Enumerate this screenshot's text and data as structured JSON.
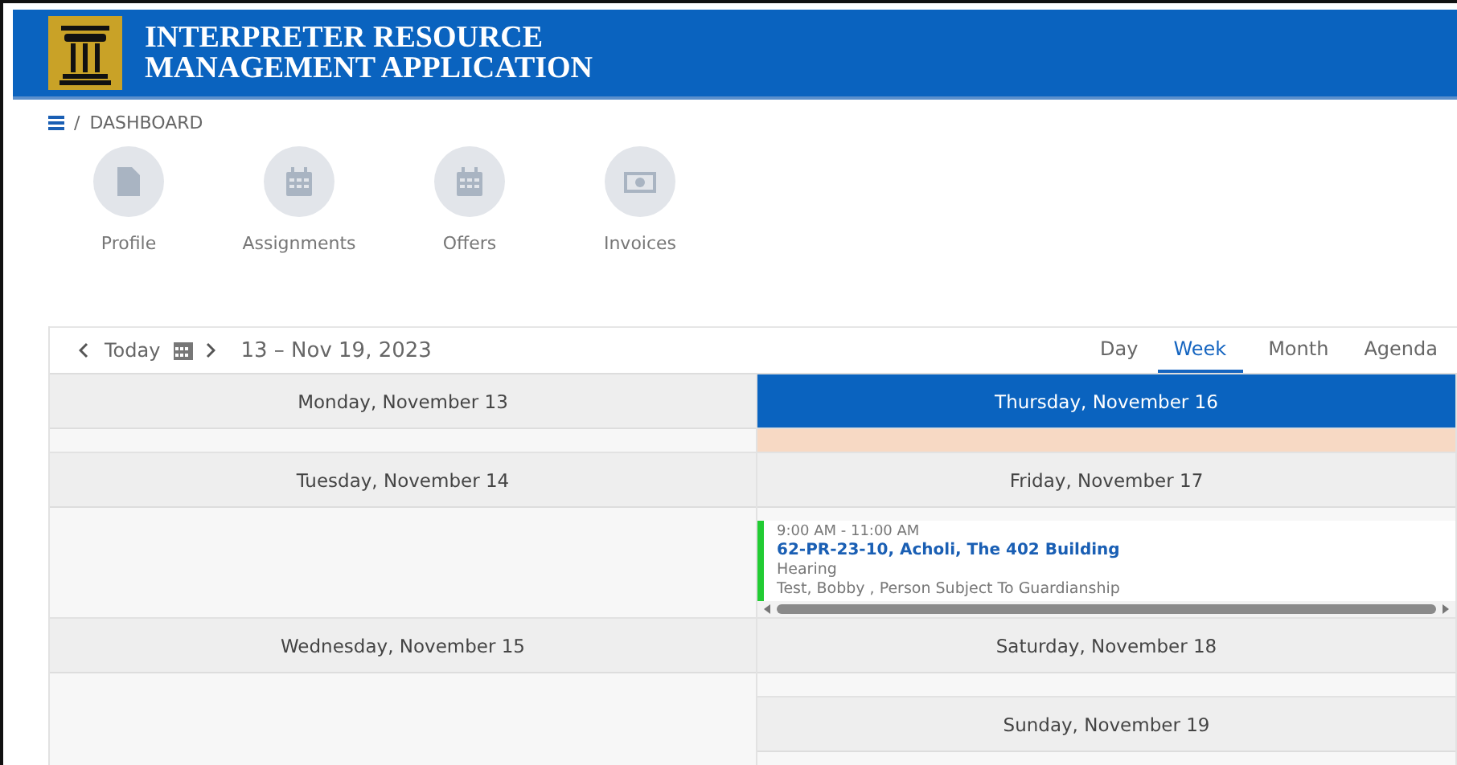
{
  "header": {
    "title_lines": [
      "INTERPRETER RESOURCE",
      "MANAGEMENT APPLICATION"
    ]
  },
  "breadcrumb": {
    "separator": "/",
    "current": "DASHBOARD"
  },
  "shortcuts": [
    {
      "label": "Profile",
      "kind": "document"
    },
    {
      "label": "Assignments",
      "kind": "calendar"
    },
    {
      "label": "Offers",
      "kind": "calendar"
    },
    {
      "label": "Invoices",
      "kind": "money"
    }
  ],
  "calendar": {
    "today_label": "Today",
    "range": "13 – Nov 19, 2023",
    "views": [
      {
        "label": "Day",
        "selected": false
      },
      {
        "label": "Week",
        "selected": true
      },
      {
        "label": "Month",
        "selected": false
      },
      {
        "label": "Agenda",
        "selected": false
      }
    ],
    "columns": [
      {
        "days": [
          {
            "label": "Monday, November 13",
            "selected": false
          },
          {
            "label": "Tuesday, November 14",
            "selected": false
          },
          {
            "label": "Wednesday, November 15",
            "selected": false
          }
        ]
      },
      {
        "days": [
          {
            "label": "Thursday, November 16",
            "selected": true
          },
          {
            "label": "Friday, November 17",
            "selected": false,
            "events": [
              {
                "time": "9:00 AM - 11:00 AM",
                "title": "62-PR-23-10, Acholi, The 402 Building",
                "type": "Hearing",
                "people": "Test, Bobby , Person Subject To Guardianship",
                "color": "#22cc33"
              }
            ]
          },
          {
            "label": "Saturday, November 18",
            "selected": false
          },
          {
            "label": "Sunday, November 19",
            "selected": false
          }
        ]
      }
    ]
  }
}
